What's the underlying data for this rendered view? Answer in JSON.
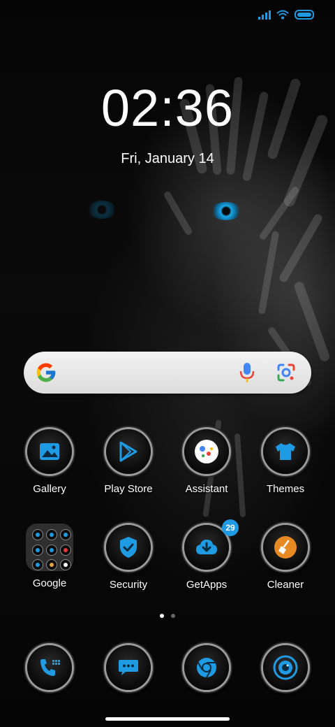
{
  "status": {
    "accent": "#1e9be3"
  },
  "lockclock": {
    "time": "02:36",
    "date": "Fri, January 14"
  },
  "search": {
    "icons": [
      "google-g-icon",
      "microphone-icon",
      "google-lens-icon"
    ]
  },
  "apps_row1": [
    {
      "label": "Gallery",
      "icon": "gallery-icon"
    },
    {
      "label": "Play Store",
      "icon": "play-store-icon"
    },
    {
      "label": "Assistant",
      "icon": "assistant-icon"
    },
    {
      "label": "Themes",
      "icon": "themes-tshirt-icon"
    }
  ],
  "apps_row2": [
    {
      "label": "Google",
      "icon": "folder-icon"
    },
    {
      "label": "Security",
      "icon": "shield-check-icon"
    },
    {
      "label": "GetApps",
      "icon": "cloud-download-icon",
      "badge": "29"
    },
    {
      "label": "Cleaner",
      "icon": "broom-icon"
    }
  ],
  "dock": [
    {
      "icon": "phone-icon"
    },
    {
      "icon": "messages-icon"
    },
    {
      "icon": "chrome-icon"
    },
    {
      "icon": "camera-icon"
    }
  ],
  "pager": {
    "pages": 2,
    "active": 0
  }
}
